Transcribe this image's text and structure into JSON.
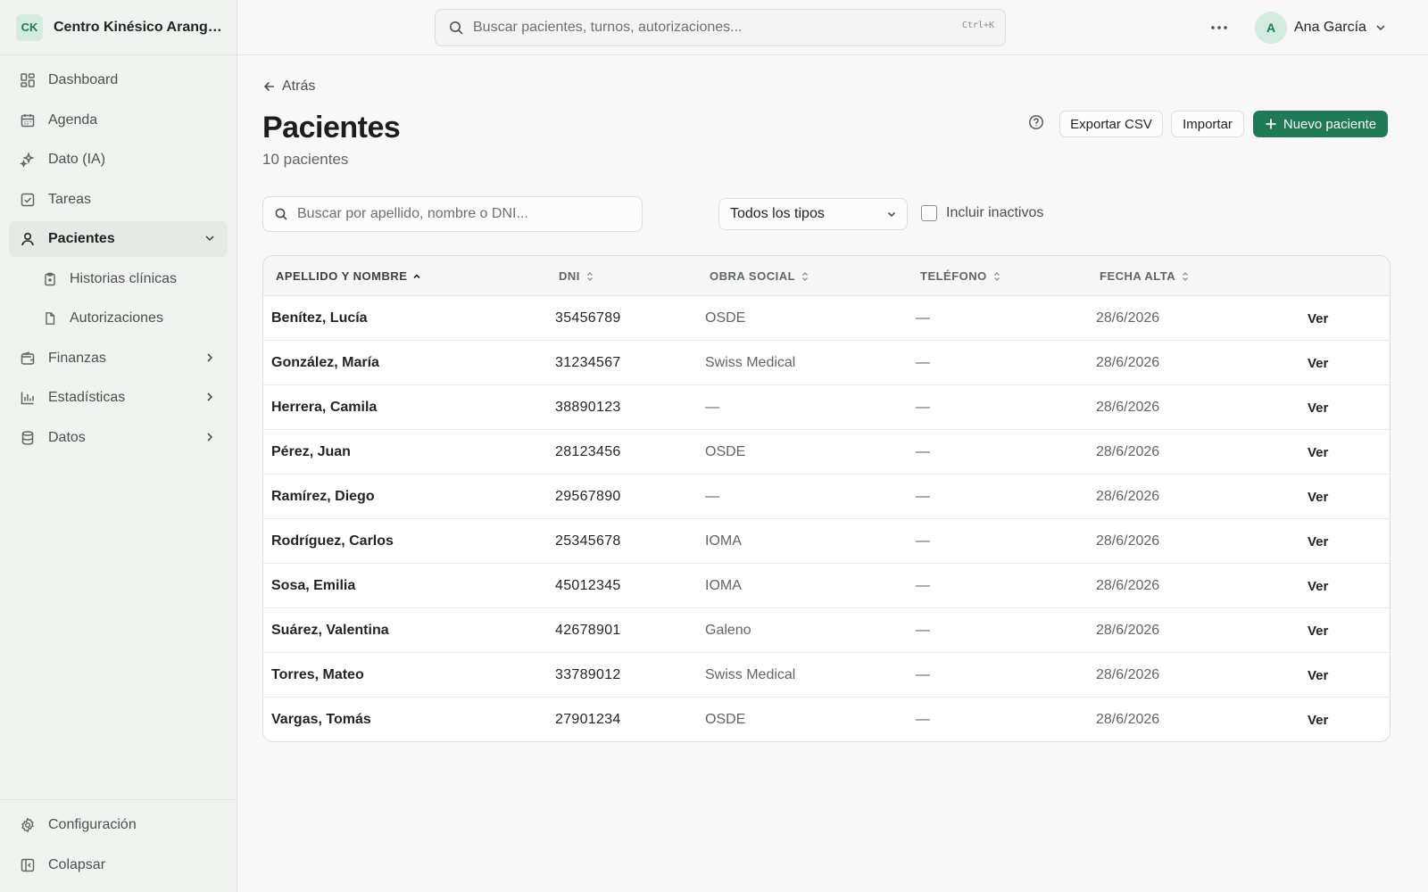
{
  "brand": {
    "initials": "CK",
    "name": "Centro Kinésico Arangu..."
  },
  "sidebar": {
    "items": [
      {
        "label": "Dashboard"
      },
      {
        "label": "Agenda"
      },
      {
        "label": "Dato (IA)"
      },
      {
        "label": "Tareas"
      },
      {
        "label": "Pacientes"
      },
      {
        "label": "Historias clínicas"
      },
      {
        "label": "Autorizaciones"
      },
      {
        "label": "Finanzas"
      },
      {
        "label": "Estadísticas"
      },
      {
        "label": "Datos"
      }
    ],
    "bottom": [
      {
        "label": "Configuración"
      },
      {
        "label": "Colapsar"
      }
    ]
  },
  "topbar": {
    "search_placeholder": "Buscar pacientes, turnos, autorizaciones...",
    "shortcut": "Ctrl+K",
    "user_initial": "A",
    "user_name": "Ana García"
  },
  "page": {
    "back_label": "Atrás",
    "title": "Pacientes",
    "subtitle": "10 pacientes",
    "export_label": "Exportar CSV",
    "import_label": "Importar",
    "new_label": "Nuevo paciente"
  },
  "filters": {
    "search_placeholder": "Buscar por apellido, nombre o DNI...",
    "type_selected": "Todos los tipos",
    "include_inactive_label": "Incluir inactivos"
  },
  "table": {
    "columns": [
      "APELLIDO Y NOMBRE",
      "DNI",
      "OBRA SOCIAL",
      "TELÉFONO",
      "FECHA ALTA"
    ],
    "rows": [
      {
        "name": "Benítez, Lucía",
        "dni": "35456789",
        "obra_social": "OSDE",
        "telefono": "—",
        "fecha_alta": "28/6/2026",
        "action": "Ver"
      },
      {
        "name": "González, María",
        "dni": "31234567",
        "obra_social": "Swiss Medical",
        "telefono": "—",
        "fecha_alta": "28/6/2026",
        "action": "Ver"
      },
      {
        "name": "Herrera, Camila",
        "dni": "38890123",
        "obra_social": "—",
        "telefono": "—",
        "fecha_alta": "28/6/2026",
        "action": "Ver"
      },
      {
        "name": "Pérez, Juan",
        "dni": "28123456",
        "obra_social": "OSDE",
        "telefono": "—",
        "fecha_alta": "28/6/2026",
        "action": "Ver"
      },
      {
        "name": "Ramírez, Diego",
        "dni": "29567890",
        "obra_social": "—",
        "telefono": "—",
        "fecha_alta": "28/6/2026",
        "action": "Ver"
      },
      {
        "name": "Rodríguez, Carlos",
        "dni": "25345678",
        "obra_social": "IOMA",
        "telefono": "—",
        "fecha_alta": "28/6/2026",
        "action": "Ver"
      },
      {
        "name": "Sosa, Emilia",
        "dni": "45012345",
        "obra_social": "IOMA",
        "telefono": "—",
        "fecha_alta": "28/6/2026",
        "action": "Ver"
      },
      {
        "name": "Suárez, Valentina",
        "dni": "42678901",
        "obra_social": "Galeno",
        "telefono": "—",
        "fecha_alta": "28/6/2026",
        "action": "Ver"
      },
      {
        "name": "Torres, Mateo",
        "dni": "33789012",
        "obra_social": "Swiss Medical",
        "telefono": "—",
        "fecha_alta": "28/6/2026",
        "action": "Ver"
      },
      {
        "name": "Vargas, Tomás",
        "dni": "27901234",
        "obra_social": "OSDE",
        "telefono": "—",
        "fecha_alta": "28/6/2026",
        "action": "Ver"
      }
    ]
  },
  "colors": {
    "accent": "#1f7a56",
    "accent_soft": "#d3ece0",
    "sidebar_bg": "#f1f3f1",
    "page_bg": "#f7f8f7"
  }
}
